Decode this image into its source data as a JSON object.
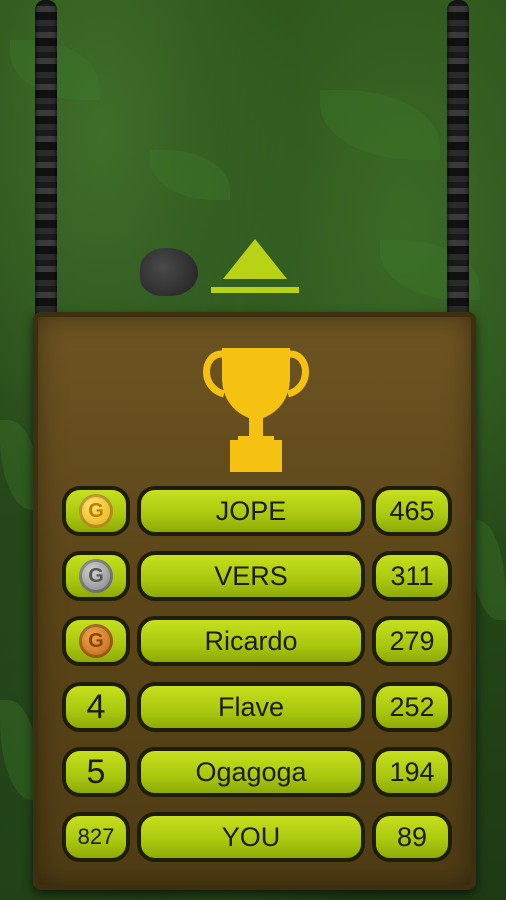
{
  "leaderboard": {
    "rows": [
      {
        "rank": "",
        "medal": "gold-medal-icon",
        "name": "JOPE",
        "score": "465"
      },
      {
        "rank": "",
        "medal": "silver-medal-icon",
        "name": "VERS",
        "score": "311"
      },
      {
        "rank": "",
        "medal": "bronze-medal-icon",
        "name": "Ricardo",
        "score": "279"
      },
      {
        "rank": "4",
        "medal": "",
        "name": "Flave",
        "score": "252"
      },
      {
        "rank": "5",
        "medal": "",
        "name": "Ogagoga",
        "score": "194"
      },
      {
        "rank": "827",
        "medal": "",
        "name": "YOU",
        "score": "89"
      }
    ],
    "medal_letter": "G"
  },
  "colors": {
    "pill": "#b4d013",
    "board": "#5f4819",
    "trophy": "#f5c211"
  },
  "icons": {
    "trophy": "trophy-icon",
    "arrow": "up-arrow-icon"
  }
}
